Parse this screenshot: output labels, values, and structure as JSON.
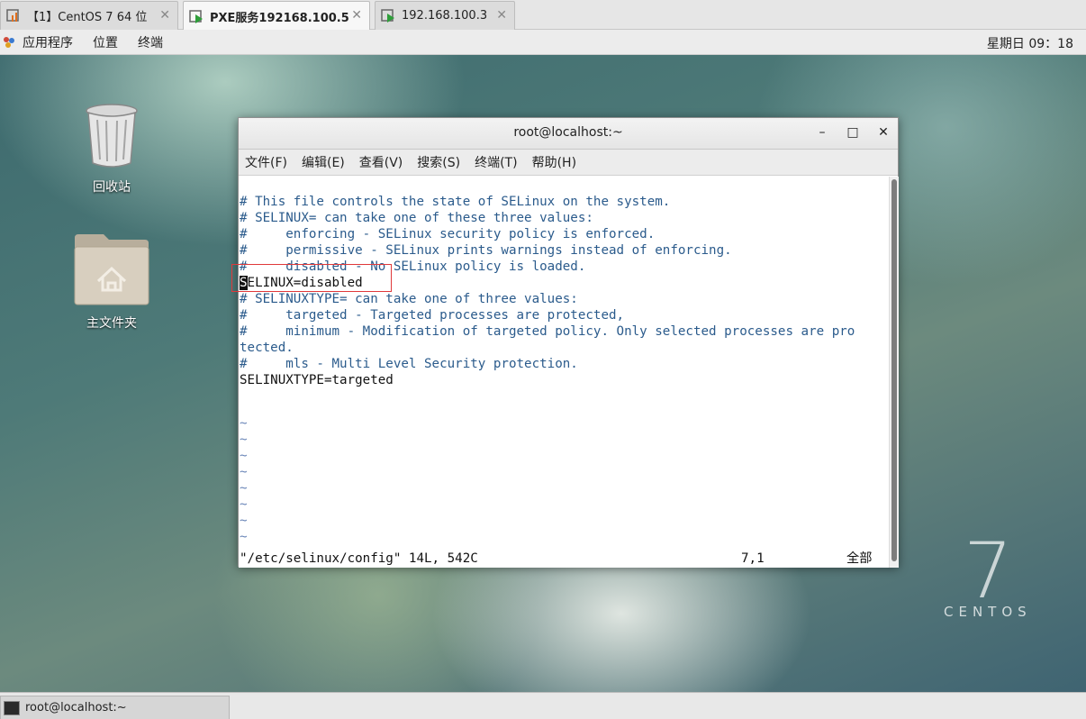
{
  "vm_tabs": [
    {
      "label": "【1】CentOS 7 64 位",
      "active": false,
      "close": "✕"
    },
    {
      "label": "PXE服务192168.100.5",
      "active": true,
      "close": "✕"
    },
    {
      "label": "192.168.100.3",
      "active": false,
      "close": "✕"
    }
  ],
  "top_panel": {
    "menus": [
      "应用程序",
      "位置",
      "终端"
    ],
    "clock": "星期日 09：18"
  },
  "desktop": {
    "icons": [
      {
        "label": "回收站",
        "icon": "trash-icon"
      },
      {
        "label": "主文件夹",
        "icon": "home-folder-icon"
      }
    ],
    "logo_word": "CENTOS",
    "logo_numeral": "7"
  },
  "terminal": {
    "title": "root@localhost:~",
    "buttons": {
      "minimize": "–",
      "maximize": "□",
      "close": "✕"
    },
    "menus": [
      "文件(F)",
      "编辑(E)",
      "查看(V)",
      "搜索(S)",
      "终端(T)",
      "帮助(H)"
    ],
    "lines": [
      {
        "text": "# This file controls the state of SELinux on the system.",
        "kind": "comment"
      },
      {
        "text": "# SELINUX= can take one of these three values:",
        "kind": "comment"
      },
      {
        "text": "#     enforcing - SELinux security policy is enforced.",
        "kind": "comment"
      },
      {
        "text": "#     permissive - SELinux prints warnings instead of enforcing.",
        "kind": "comment"
      },
      {
        "text": "#     disabled - No SELinux policy is loaded.",
        "kind": "comment"
      },
      {
        "text": "ELINUX=disabled",
        "kind": "plain",
        "cursor_char": "S"
      },
      {
        "text": "# SELINUXTYPE= can take one of three values:",
        "kind": "comment"
      },
      {
        "text": "#     targeted - Targeted processes are protected,",
        "kind": "comment"
      },
      {
        "text": "#     minimum - Modification of targeted policy. Only selected processes are pro",
        "kind": "comment"
      },
      {
        "text": "tected.",
        "kind": "comment"
      },
      {
        "text": "#     mls - Multi Level Security protection.",
        "kind": "comment"
      },
      {
        "text": "SELINUXTYPE=targeted",
        "kind": "plain"
      }
    ],
    "tildes": [
      "~",
      "~",
      "~",
      "~",
      "~",
      "~",
      "~",
      "~"
    ],
    "status": {
      "file": "\"/etc/selinux/config\" 14L, 542C",
      "position": "7,1",
      "scroll": "全部"
    }
  },
  "taskbar": {
    "item_label": "root@localhost:~"
  }
}
